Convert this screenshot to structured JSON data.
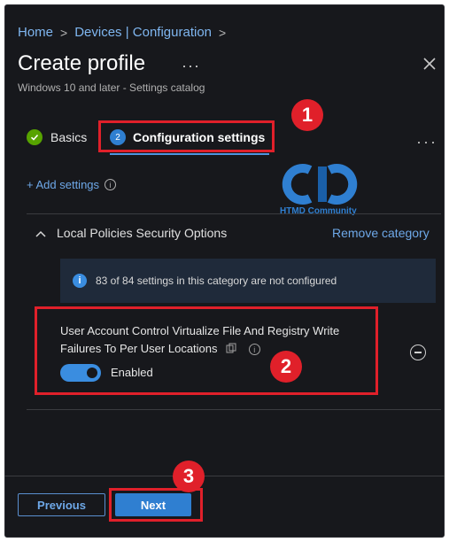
{
  "breadcrumb": {
    "home": "Home",
    "sep": ">",
    "devices": "Devices | Configuration"
  },
  "header": {
    "title": "Create profile",
    "title_more": "···",
    "subtitle": "Windows 10 and later - Settings catalog",
    "close_icon": "close-icon"
  },
  "steps": {
    "basics_label": "Basics",
    "config_number": "2",
    "config_label": "Configuration settings",
    "more": "···"
  },
  "add_settings": {
    "label": "+ Add settings",
    "info": "i"
  },
  "logo": {
    "text": "HTMD Community",
    "accent": "#2f7fd1"
  },
  "category": {
    "name": "Local Policies Security Options",
    "remove_label": "Remove category",
    "banner_text": "83 of 84 settings in this category are not configured",
    "banner_icon": "i"
  },
  "setting": {
    "label": "User Account Control Virtualize File And Registry Write Failures To Per User Locations",
    "toggle_state": "Enabled",
    "toggle_on": true
  },
  "footer": {
    "previous_label": "Previous",
    "next_label": "Next"
  },
  "annotations": {
    "one": "1",
    "two": "2",
    "three": "3",
    "color": "#e0202a"
  }
}
